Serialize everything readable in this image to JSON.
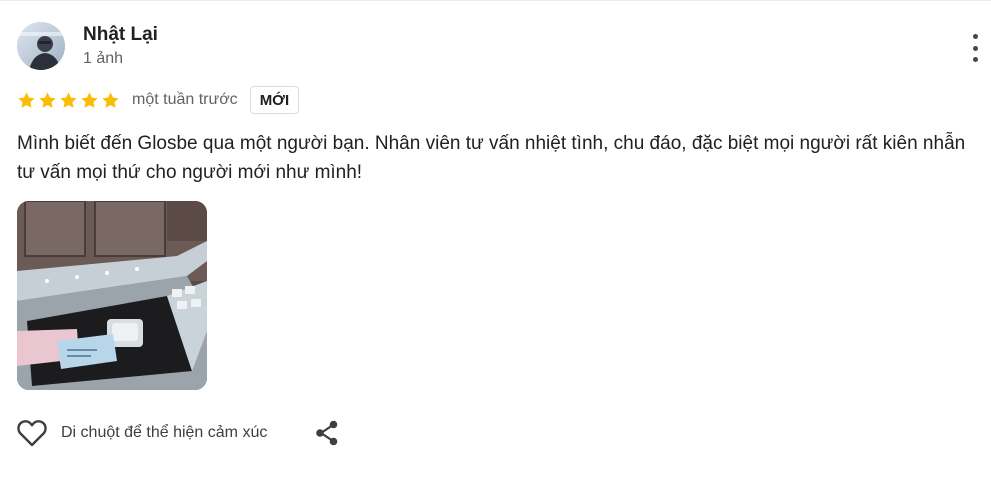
{
  "review": {
    "author": {
      "name": "Nhật Lại",
      "meta": "1 ảnh"
    },
    "rating": 5,
    "rating_max": 5,
    "time": "một tuần trước",
    "badge": "MỚI",
    "text": "Mình biết đến Glosbe qua một người bạn. Nhân viên tư vấn nhiệt tình, chu đáo, đặc biệt mọi người rất kiên nhẫn tư vấn mọi thứ cho người mới như mình!",
    "photo_count": 1
  },
  "actions": {
    "like_label": "Di chuột để thể hiện cảm xúc",
    "like_icon": "heart-outline-icon",
    "share_icon": "share-icon",
    "more_icon": "more-vert-icon"
  },
  "colors": {
    "star": "#fbbc04",
    "text": "#202124",
    "secondary": "#5f6368"
  }
}
